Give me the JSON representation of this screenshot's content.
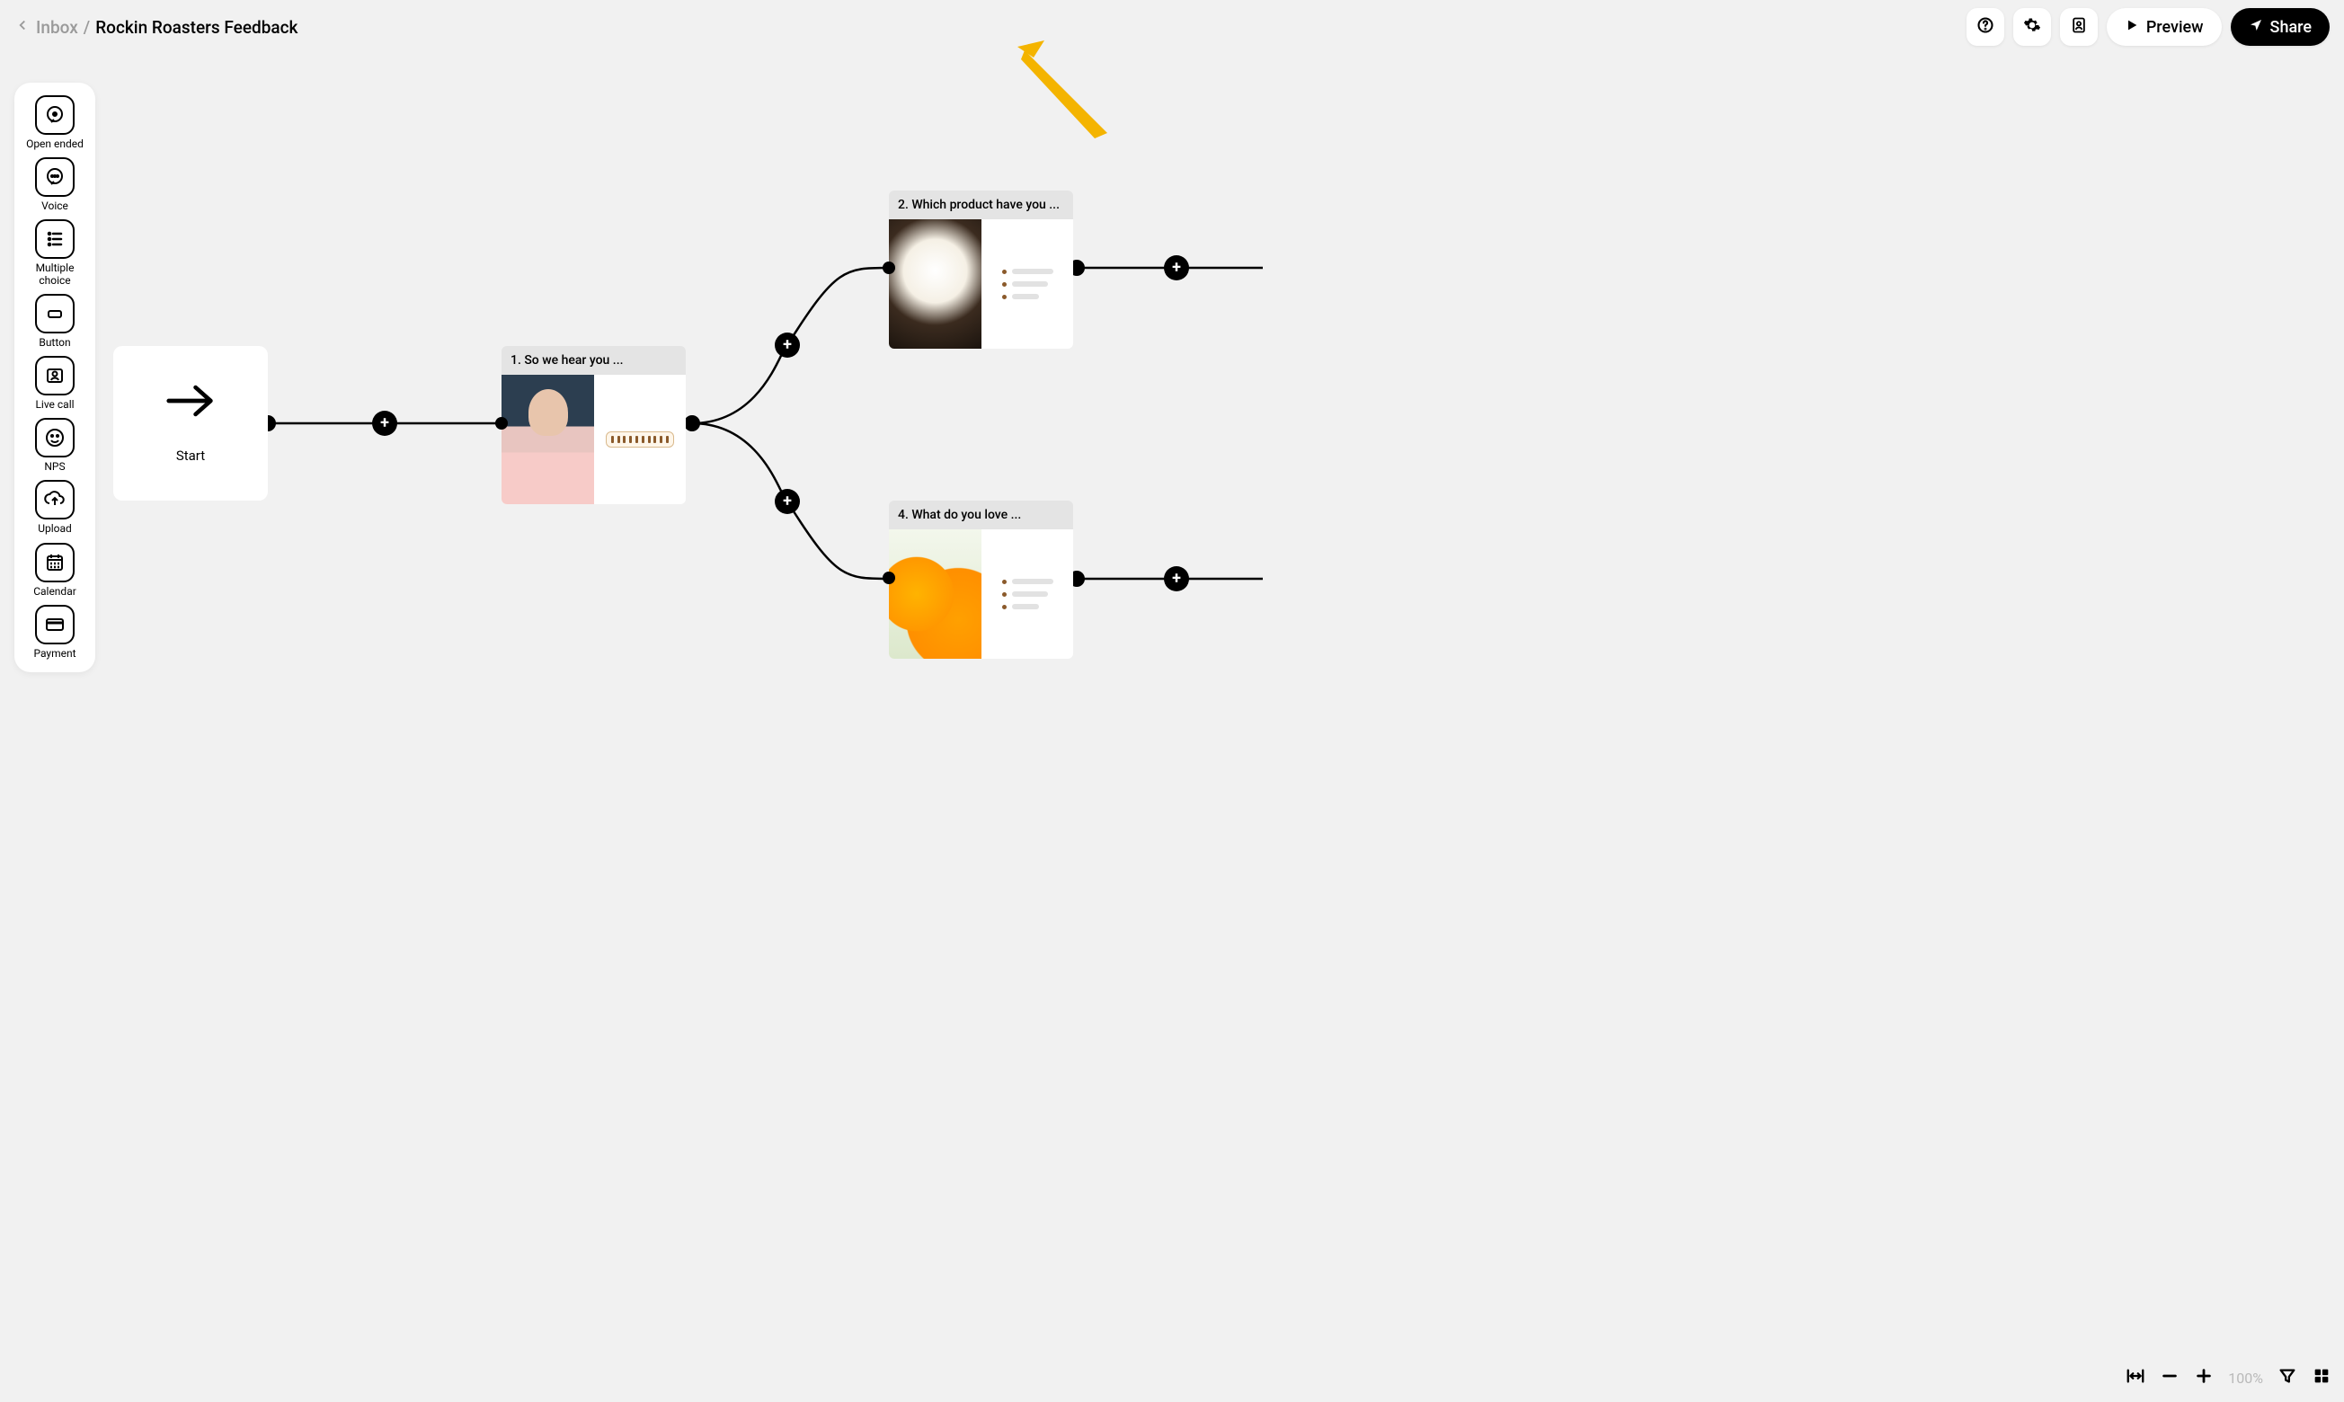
{
  "breadcrumb": {
    "inbox": "Inbox",
    "slash": "/",
    "project": "Rockin Roasters Feedback"
  },
  "header": {
    "preview": "Preview",
    "share": "Share"
  },
  "toolbox": [
    {
      "id": "open-ended",
      "label": "Open ended"
    },
    {
      "id": "voice",
      "label": "Voice"
    },
    {
      "id": "multiple-choice",
      "label": "Multiple choice"
    },
    {
      "id": "button",
      "label": "Button"
    },
    {
      "id": "live-call",
      "label": "Live call"
    },
    {
      "id": "nps",
      "label": "NPS"
    },
    {
      "id": "upload",
      "label": "Upload"
    },
    {
      "id": "calendar",
      "label": "Calendar"
    },
    {
      "id": "payment",
      "label": "Payment"
    }
  ],
  "start": {
    "label": "Start"
  },
  "nodes": {
    "n1": {
      "title": "1. So we hear you ..."
    },
    "n2": {
      "title": "2. Which product have you ..."
    },
    "n4": {
      "title": "4. What do you love ..."
    }
  },
  "bottom": {
    "zoom": "100%"
  }
}
